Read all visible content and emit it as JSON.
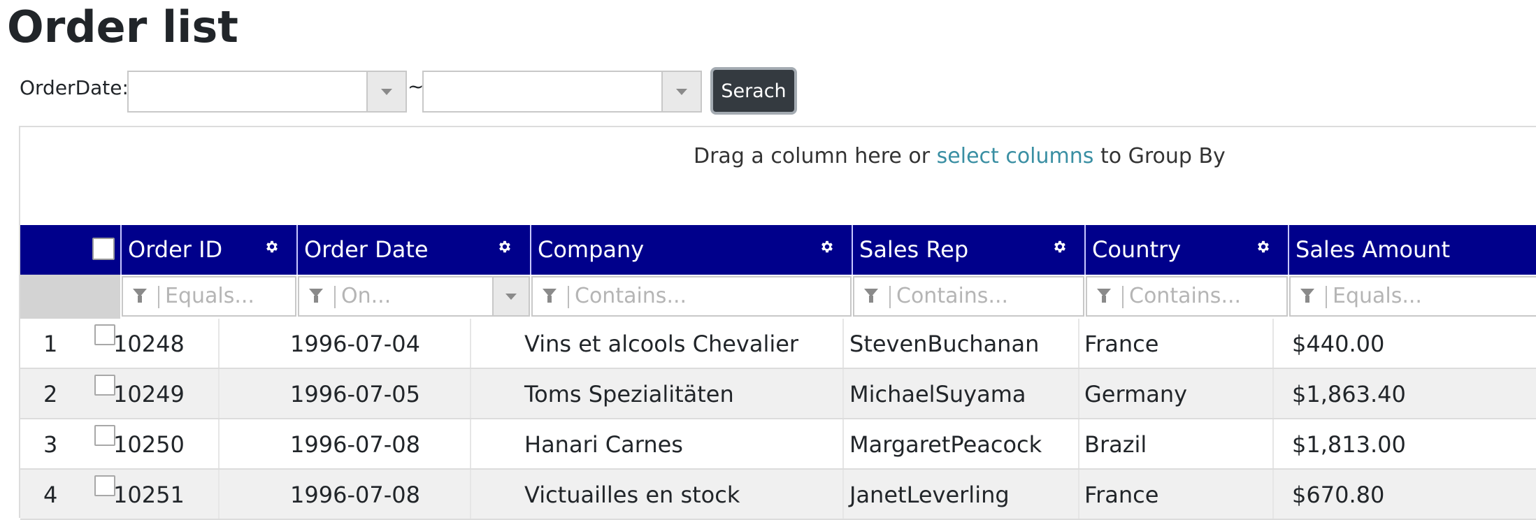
{
  "page": {
    "title": "Order list"
  },
  "date_filter": {
    "label": "OrderDate:",
    "from_value": "",
    "separator": "~",
    "to_value": ""
  },
  "search_button": {
    "label": "Serach"
  },
  "grid": {
    "group_panel": {
      "prefix": "Drag a column here or ",
      "link": "select columns",
      "suffix": " to Group By"
    },
    "colors": {
      "header_bg": "#00008b",
      "header_text": "#ffffff",
      "alt_row": "#f0f0f0",
      "link": "#3a8fa3"
    },
    "columns": [
      {
        "key": "order_id",
        "label": "Order ID",
        "filter_placeholder": "Equals...",
        "has_settings": true
      },
      {
        "key": "order_date",
        "label": "Order Date",
        "filter_placeholder": "On...",
        "has_settings": true
      },
      {
        "key": "company",
        "label": "Company",
        "filter_placeholder": "Contains...",
        "has_settings": true
      },
      {
        "key": "sales_rep",
        "label": "Sales Rep",
        "filter_placeholder": "Contains...",
        "has_settings": true
      },
      {
        "key": "country",
        "label": "Country",
        "filter_placeholder": "Contains...",
        "has_settings": true
      },
      {
        "key": "sales_amount",
        "label": "Sales Amount",
        "filter_placeholder": "Equals...",
        "has_settings": false
      }
    ],
    "rows": [
      {
        "num": "1",
        "order_id": "10248",
        "order_date": "1996-07-04",
        "company": "Vins et alcools Chevalier",
        "sales_rep": "StevenBuchanan",
        "country": "France",
        "sales_amount": "$440.00"
      },
      {
        "num": "2",
        "order_id": "10249",
        "order_date": "1996-07-05",
        "company": "Toms Spezialitäten",
        "sales_rep": "MichaelSuyama",
        "country": "Germany",
        "sales_amount": "$1,863.40"
      },
      {
        "num": "3",
        "order_id": "10250",
        "order_date": "1996-07-08",
        "company": "Hanari Carnes",
        "sales_rep": "MargaretPeacock",
        "country": "Brazil",
        "sales_amount": "$1,813.00"
      },
      {
        "num": "4",
        "order_id": "10251",
        "order_date": "1996-07-08",
        "company": "Victuailles en stock",
        "sales_rep": "JanetLeverling",
        "country": "France",
        "sales_amount": "$670.80"
      }
    ]
  }
}
